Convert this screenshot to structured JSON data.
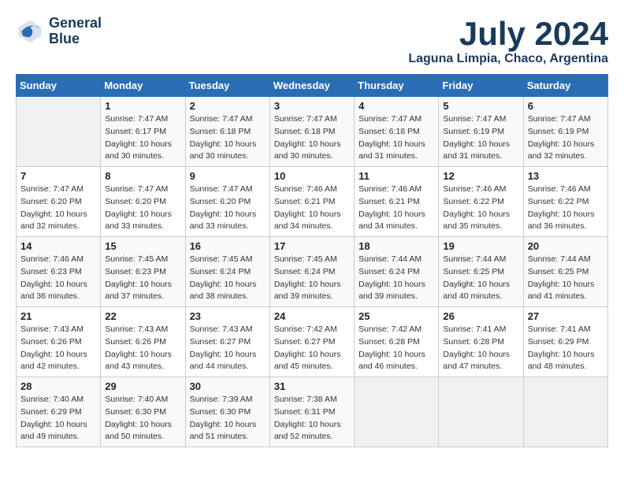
{
  "header": {
    "logo_line1": "General",
    "logo_line2": "Blue",
    "month": "July 2024",
    "location": "Laguna Limpia, Chaco, Argentina"
  },
  "calendar": {
    "weekdays": [
      "Sunday",
      "Monday",
      "Tuesday",
      "Wednesday",
      "Thursday",
      "Friday",
      "Saturday"
    ],
    "weeks": [
      [
        {
          "day": "",
          "info": ""
        },
        {
          "day": "1",
          "info": "Sunrise: 7:47 AM\nSunset: 6:17 PM\nDaylight: 10 hours\nand 30 minutes."
        },
        {
          "day": "2",
          "info": "Sunrise: 7:47 AM\nSunset: 6:18 PM\nDaylight: 10 hours\nand 30 minutes."
        },
        {
          "day": "3",
          "info": "Sunrise: 7:47 AM\nSunset: 6:18 PM\nDaylight: 10 hours\nand 30 minutes."
        },
        {
          "day": "4",
          "info": "Sunrise: 7:47 AM\nSunset: 6:18 PM\nDaylight: 10 hours\nand 31 minutes."
        },
        {
          "day": "5",
          "info": "Sunrise: 7:47 AM\nSunset: 6:19 PM\nDaylight: 10 hours\nand 31 minutes."
        },
        {
          "day": "6",
          "info": "Sunrise: 7:47 AM\nSunset: 6:19 PM\nDaylight: 10 hours\nand 32 minutes."
        }
      ],
      [
        {
          "day": "7",
          "info": "Sunrise: 7:47 AM\nSunset: 6:20 PM\nDaylight: 10 hours\nand 32 minutes."
        },
        {
          "day": "8",
          "info": "Sunrise: 7:47 AM\nSunset: 6:20 PM\nDaylight: 10 hours\nand 33 minutes."
        },
        {
          "day": "9",
          "info": "Sunrise: 7:47 AM\nSunset: 6:20 PM\nDaylight: 10 hours\nand 33 minutes."
        },
        {
          "day": "10",
          "info": "Sunrise: 7:46 AM\nSunset: 6:21 PM\nDaylight: 10 hours\nand 34 minutes."
        },
        {
          "day": "11",
          "info": "Sunrise: 7:46 AM\nSunset: 6:21 PM\nDaylight: 10 hours\nand 34 minutes."
        },
        {
          "day": "12",
          "info": "Sunrise: 7:46 AM\nSunset: 6:22 PM\nDaylight: 10 hours\nand 35 minutes."
        },
        {
          "day": "13",
          "info": "Sunrise: 7:46 AM\nSunset: 6:22 PM\nDaylight: 10 hours\nand 36 minutes."
        }
      ],
      [
        {
          "day": "14",
          "info": "Sunrise: 7:46 AM\nSunset: 6:23 PM\nDaylight: 10 hours\nand 36 minutes."
        },
        {
          "day": "15",
          "info": "Sunrise: 7:45 AM\nSunset: 6:23 PM\nDaylight: 10 hours\nand 37 minutes."
        },
        {
          "day": "16",
          "info": "Sunrise: 7:45 AM\nSunset: 6:24 PM\nDaylight: 10 hours\nand 38 minutes."
        },
        {
          "day": "17",
          "info": "Sunrise: 7:45 AM\nSunset: 6:24 PM\nDaylight: 10 hours\nand 39 minutes."
        },
        {
          "day": "18",
          "info": "Sunrise: 7:44 AM\nSunset: 6:24 PM\nDaylight: 10 hours\nand 39 minutes."
        },
        {
          "day": "19",
          "info": "Sunrise: 7:44 AM\nSunset: 6:25 PM\nDaylight: 10 hours\nand 40 minutes."
        },
        {
          "day": "20",
          "info": "Sunrise: 7:44 AM\nSunset: 6:25 PM\nDaylight: 10 hours\nand 41 minutes."
        }
      ],
      [
        {
          "day": "21",
          "info": "Sunrise: 7:43 AM\nSunset: 6:26 PM\nDaylight: 10 hours\nand 42 minutes."
        },
        {
          "day": "22",
          "info": "Sunrise: 7:43 AM\nSunset: 6:26 PM\nDaylight: 10 hours\nand 43 minutes."
        },
        {
          "day": "23",
          "info": "Sunrise: 7:43 AM\nSunset: 6:27 PM\nDaylight: 10 hours\nand 44 minutes."
        },
        {
          "day": "24",
          "info": "Sunrise: 7:42 AM\nSunset: 6:27 PM\nDaylight: 10 hours\nand 45 minutes."
        },
        {
          "day": "25",
          "info": "Sunrise: 7:42 AM\nSunset: 6:28 PM\nDaylight: 10 hours\nand 46 minutes."
        },
        {
          "day": "26",
          "info": "Sunrise: 7:41 AM\nSunset: 6:28 PM\nDaylight: 10 hours\nand 47 minutes."
        },
        {
          "day": "27",
          "info": "Sunrise: 7:41 AM\nSunset: 6:29 PM\nDaylight: 10 hours\nand 48 minutes."
        }
      ],
      [
        {
          "day": "28",
          "info": "Sunrise: 7:40 AM\nSunset: 6:29 PM\nDaylight: 10 hours\nand 49 minutes."
        },
        {
          "day": "29",
          "info": "Sunrise: 7:40 AM\nSunset: 6:30 PM\nDaylight: 10 hours\nand 50 minutes."
        },
        {
          "day": "30",
          "info": "Sunrise: 7:39 AM\nSunset: 6:30 PM\nDaylight: 10 hours\nand 51 minutes."
        },
        {
          "day": "31",
          "info": "Sunrise: 7:38 AM\nSunset: 6:31 PM\nDaylight: 10 hours\nand 52 minutes."
        },
        {
          "day": "",
          "info": ""
        },
        {
          "day": "",
          "info": ""
        },
        {
          "day": "",
          "info": ""
        }
      ]
    ]
  }
}
